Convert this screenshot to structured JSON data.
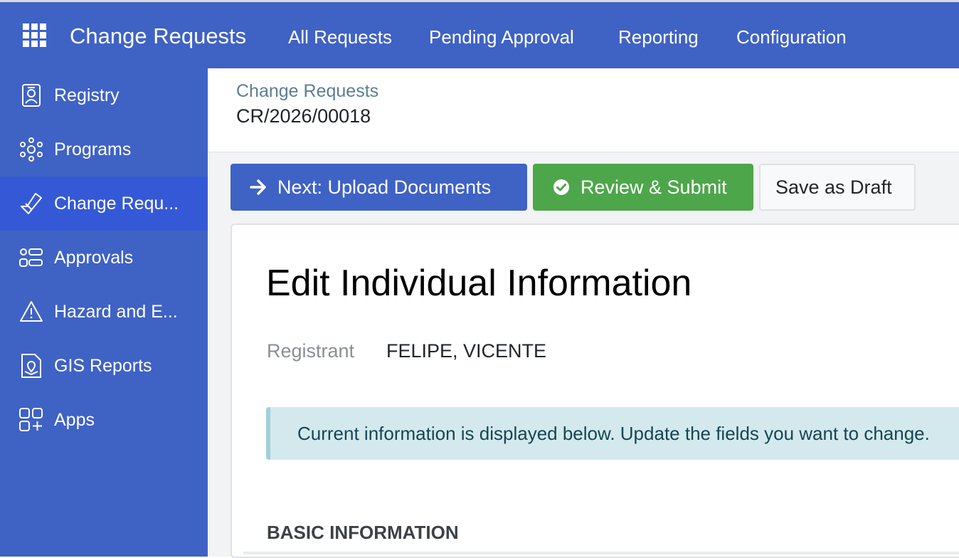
{
  "topbar": {
    "app_title": "Change Requests",
    "nav": [
      "All Requests",
      "Pending Approval",
      "Reporting",
      "Configuration"
    ]
  },
  "sidebar": {
    "items": [
      {
        "label": "Registry",
        "icon": "registry-icon"
      },
      {
        "label": "Programs",
        "icon": "programs-icon"
      },
      {
        "label": "Change Requ...",
        "icon": "change-request-icon",
        "active": true
      },
      {
        "label": "Approvals",
        "icon": "approvals-icon"
      },
      {
        "label": "Hazard and E...",
        "icon": "warning-icon"
      },
      {
        "label": "GIS Reports",
        "icon": "gis-report-icon"
      },
      {
        "label": "Apps",
        "icon": "apps-icon"
      }
    ]
  },
  "breadcrumb": {
    "parent": "Change Requests",
    "current": "CR/2026/00018"
  },
  "actions": {
    "next_label": "Next: Upload Documents",
    "review_label": "Review & Submit",
    "draft_label": "Save as Draft"
  },
  "form": {
    "title": "Edit Individual Information",
    "registrant_label": "Registrant",
    "registrant_value": "FELIPE, VICENTE",
    "alert_text": "Current information is displayed below. Update the fields you want to change.",
    "section_heading": "BASIC INFORMATION"
  },
  "colors": {
    "primary": "#3f62c5",
    "success": "#4ea64b",
    "alert_bg": "#d3e9ee"
  }
}
